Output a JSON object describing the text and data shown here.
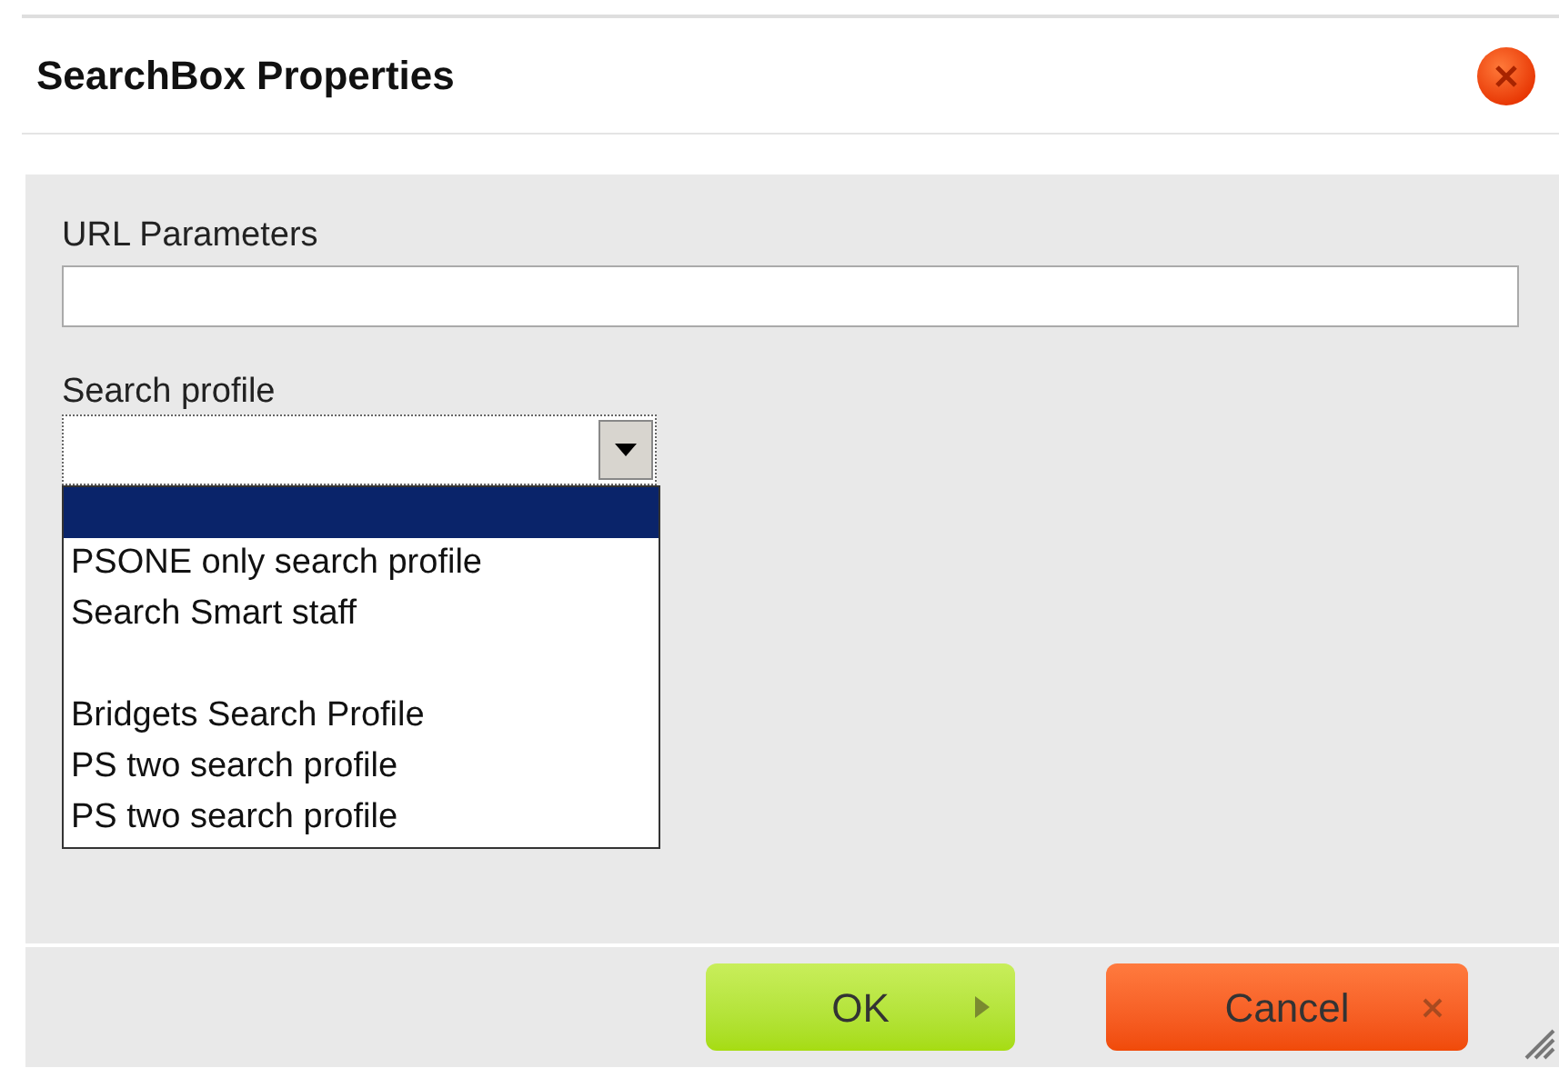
{
  "dialog": {
    "title": "SearchBox Properties"
  },
  "fields": [
    {
      "kind": "text",
      "label": "URL Parameters"
    },
    {
      "kind": "select",
      "label": "Search profile",
      "options": [
        {
          "selected": true
        },
        {
          "label": "PSONE only search profile",
          "selected": false
        },
        {
          "label": "Search Smart staff",
          "selected": false
        },
        {
          "selected": false
        },
        {
          "label": "Bridgets Search Profile",
          "selected": false
        },
        {
          "label": "PS two search profile",
          "selected": false
        },
        {
          "label": "PS two search profile",
          "selected": false
        }
      ]
    }
  ],
  "buttons": [
    {
      "kind": "ok",
      "label": "OK"
    },
    {
      "kind": "cancel",
      "label": "Cancel"
    }
  ]
}
